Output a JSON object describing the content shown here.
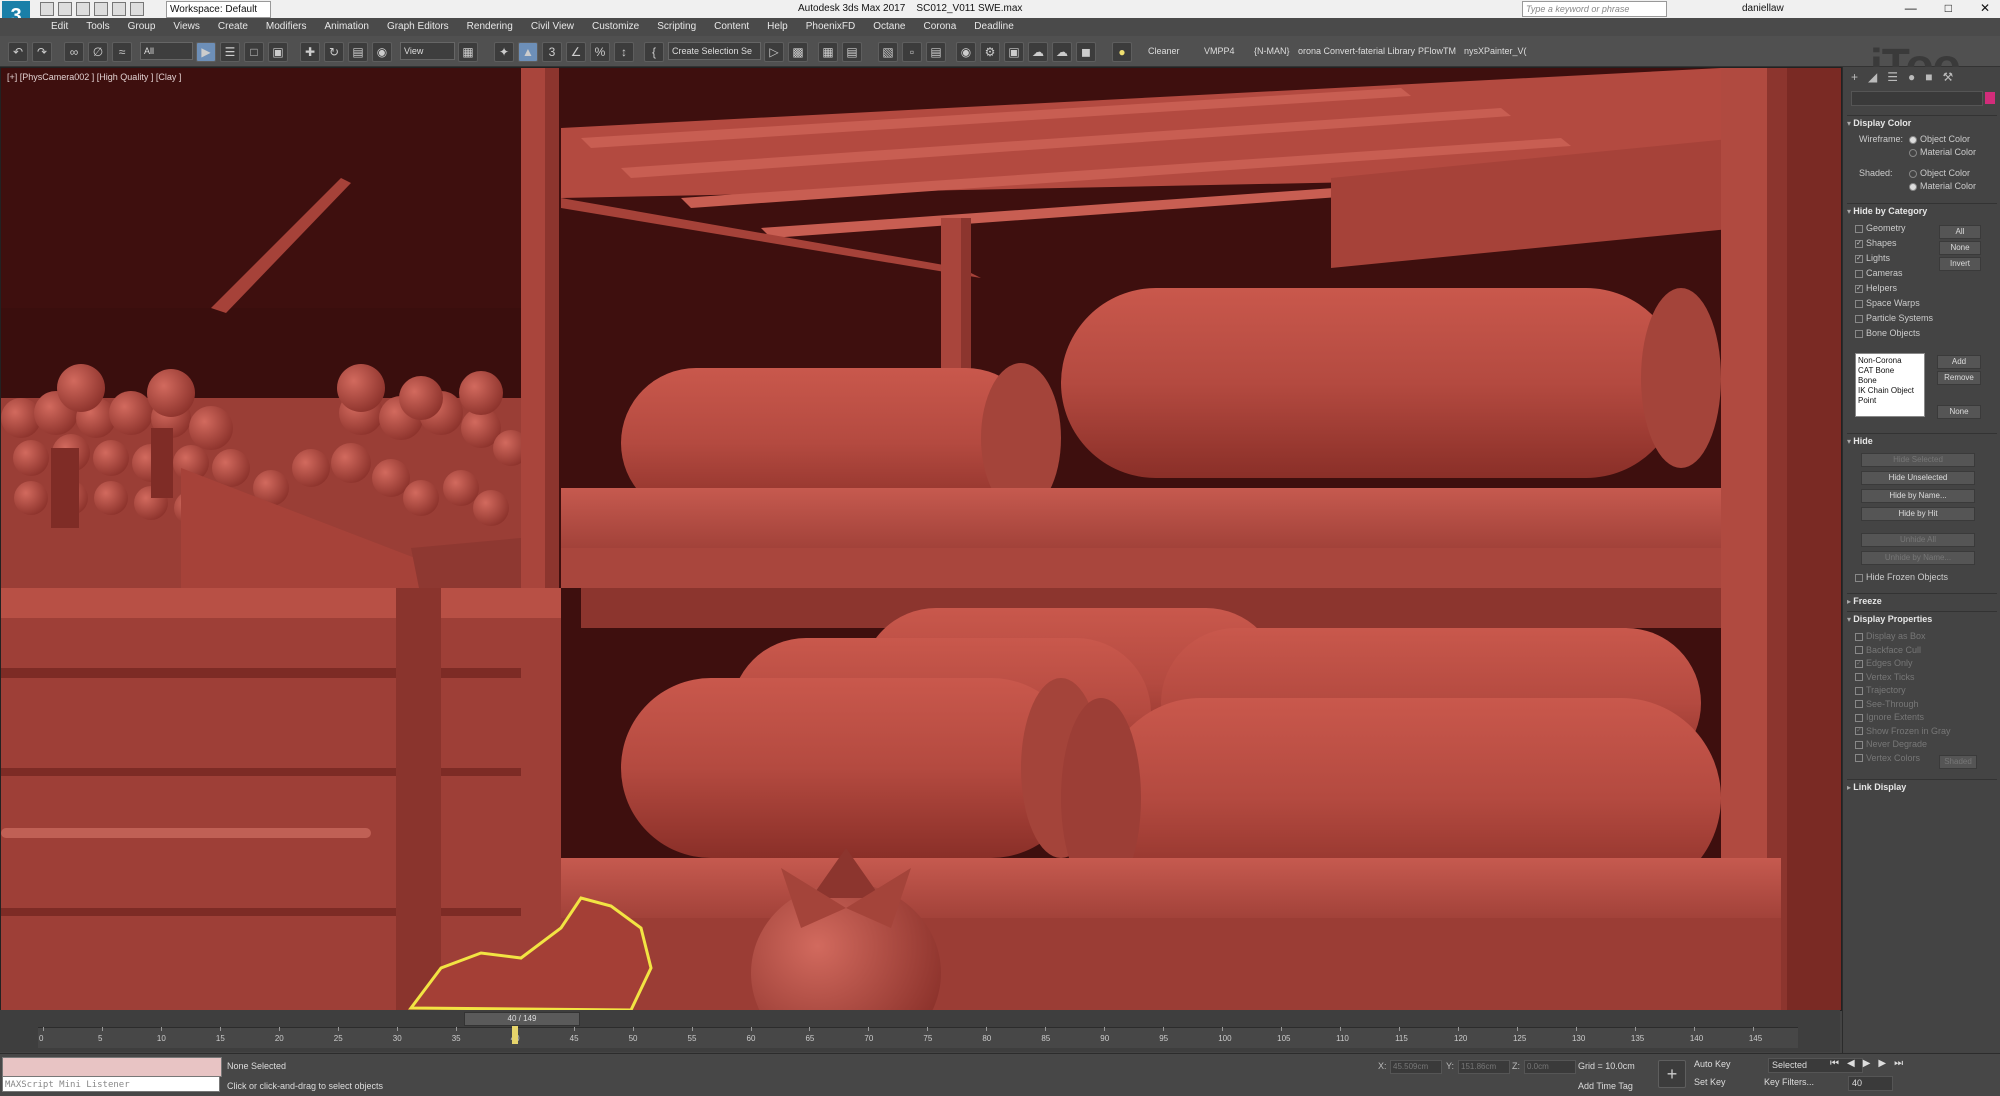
{
  "window": {
    "app_title": "Autodesk 3ds Max 2017",
    "file_name": "SC012_V011 SWE.max",
    "workspace": "Workspace: Default",
    "search_placeholder": "Type a keyword or phrase",
    "user": "daniellaw"
  },
  "menu": [
    "Edit",
    "Tools",
    "Group",
    "Views",
    "Create",
    "Modifiers",
    "Animation",
    "Graph Editors",
    "Rendering",
    "Civil View",
    "Customize",
    "Scripting",
    "Content",
    "Help",
    "PhoenixFD",
    "Octane",
    "Corona",
    "Deadline"
  ],
  "toolbar": {
    "filter": "All",
    "refcoord": "View",
    "selection_set": "Create Selection Se",
    "items": [
      "Cleaner",
      "VMPP4",
      "{N-MAN}",
      "orona Convert-faterial Library",
      "PFlowTM",
      "nysXPainter_V("
    ]
  },
  "brand_watermark": "iToo",
  "viewport": {
    "label": "[+] [PhysCamera002 ] [High Quality ] [Clay ]",
    "clay_color": "#b04a40"
  },
  "command_panel": {
    "display_color": {
      "title": "Display Color",
      "wireframe_label": "Wireframe:",
      "shaded_label": "Shaded:",
      "object_color": "Object Color",
      "material_color": "Material Color"
    },
    "hide_by_category": {
      "title": "Hide by Category",
      "items": [
        {
          "label": "Geometry",
          "checked": false
        },
        {
          "label": "Shapes",
          "checked": true
        },
        {
          "label": "Lights",
          "checked": true
        },
        {
          "label": "Cameras",
          "checked": false
        },
        {
          "label": "Helpers",
          "checked": true
        },
        {
          "label": "Space Warps",
          "checked": false
        },
        {
          "label": "Particle Systems",
          "checked": false
        },
        {
          "label": "Bone Objects",
          "checked": false
        }
      ],
      "btn_all": "All",
      "btn_none": "None",
      "btn_invert": "Invert",
      "list": [
        "Non-Corona",
        "CAT Bone",
        "Bone",
        "IK Chain Object",
        "Point"
      ],
      "btn_add": "Add",
      "btn_remove": "Remove",
      "btn_none2": "None"
    },
    "hide": {
      "title": "Hide",
      "hide_selected": "Hide Selected",
      "hide_unselected": "Hide Unselected",
      "hide_by_name": "Hide by Name...",
      "hide_by_hit": "Hide by Hit",
      "unhide_all": "Unhide All",
      "unhide_by_name": "Unhide by Name...",
      "hide_frozen": "Hide Frozen Objects"
    },
    "freeze": {
      "title": "Freeze"
    },
    "display_properties": {
      "title": "Display Properties",
      "items": [
        {
          "label": "Display as Box",
          "checked": false
        },
        {
          "label": "Backface Cull",
          "checked": false
        },
        {
          "label": "Edges Only",
          "checked": true
        },
        {
          "label": "Vertex Ticks",
          "checked": false
        },
        {
          "label": "Trajectory",
          "checked": false
        },
        {
          "label": "See-Through",
          "checked": false
        },
        {
          "label": "Ignore Extents",
          "checked": false
        },
        {
          "label": "Show Frozen in Gray",
          "checked": true
        },
        {
          "label": "Never Degrade",
          "checked": false
        },
        {
          "label": "Vertex Colors",
          "checked": false
        }
      ],
      "shaded_btn": "Shaded"
    },
    "link_display": {
      "title": "Link Display"
    }
  },
  "timeline": {
    "slider_label": "40 / 149",
    "current_frame": 40,
    "max_frame": 149,
    "ticks": [
      0,
      5,
      10,
      15,
      20,
      25,
      30,
      35,
      40,
      45,
      50,
      55,
      60,
      65,
      70,
      75,
      80,
      85,
      90,
      95,
      100,
      105,
      110,
      115,
      120,
      125,
      130,
      135,
      140,
      145
    ]
  },
  "status": {
    "maxscript": "MAXScript Mini Listener",
    "selection": "None Selected",
    "prompt": "Click or click-and-drag to select objects",
    "x_label": "X:",
    "x_value": "45.509cm",
    "y_label": "Y:",
    "y_value": "151.86cm",
    "z_label": "Z:",
    "z_value": "0.0cm",
    "grid": "Grid = 10.0cm",
    "add_time_tag": "Add Time Tag",
    "auto_key": "Auto Key",
    "set_key": "Set Key",
    "selected": "Selected",
    "key_filters": "Key Filters...",
    "frame_field": "40"
  }
}
